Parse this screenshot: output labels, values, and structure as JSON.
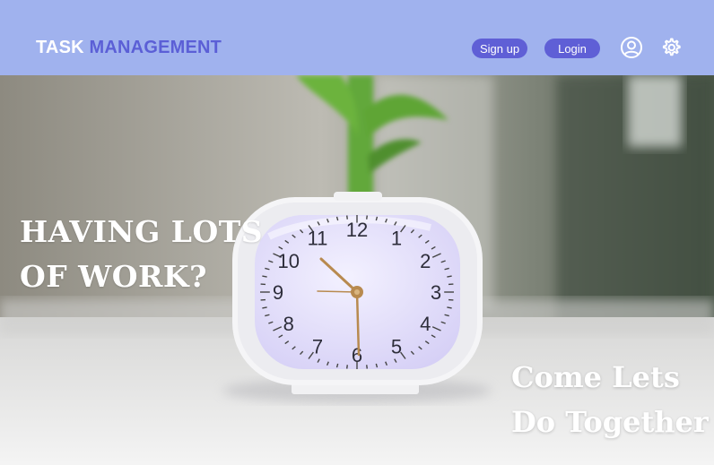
{
  "header": {
    "brand_part1": "TASK",
    "brand_part2": "MANAGEMENT",
    "signup_label": "Sign up",
    "login_label": "Login",
    "profile_icon": "user-circle-icon",
    "settings_icon": "gear-icon"
  },
  "hero": {
    "headline_line1": "HAVING LOTS",
    "headline_line2": "OF WORK?",
    "tagline_line1": "Come Lets",
    "tagline_line2": "Do Together",
    "clock_numbers": [
      "12",
      "1",
      "2",
      "3",
      "4",
      "5",
      "6",
      "7",
      "8",
      "9",
      "10",
      "11"
    ]
  },
  "colors": {
    "header_bg": "#a0b2ee",
    "accent": "#5f5fd6",
    "brand_accent": "#5b5fd6"
  }
}
